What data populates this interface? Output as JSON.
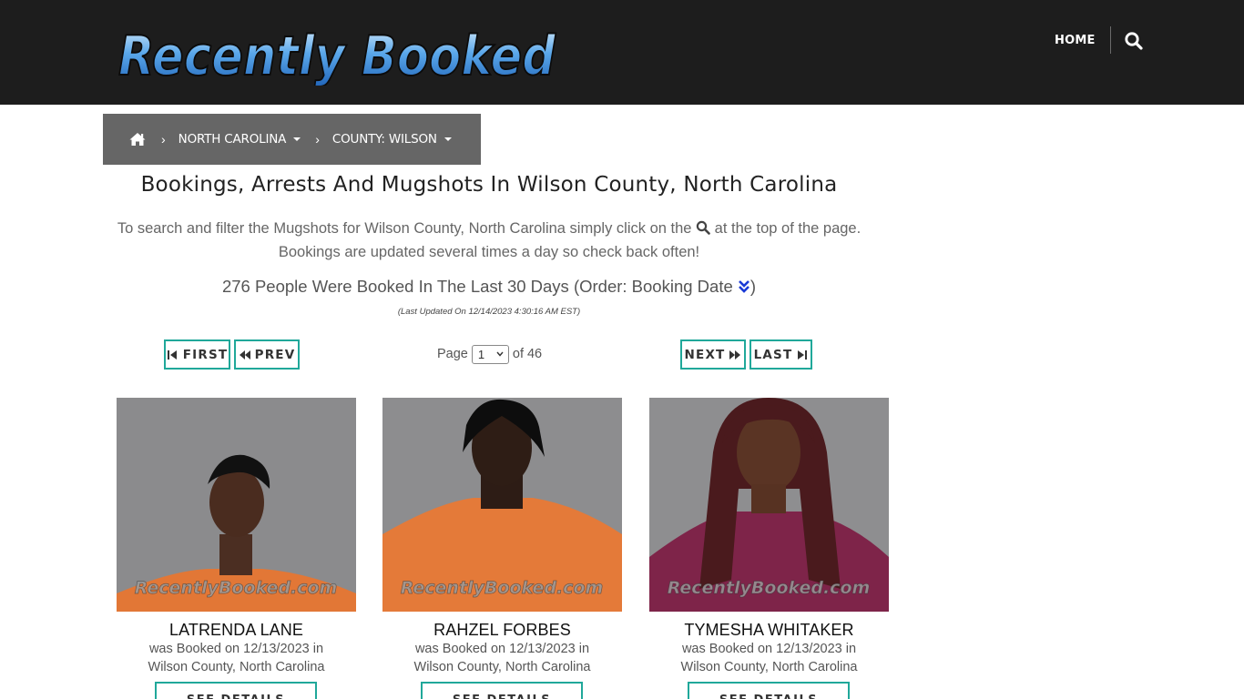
{
  "header": {
    "logo_text": "Recently Booked",
    "nav_home": "HOME",
    "search_icon": "search-icon"
  },
  "breadcrumb": {
    "home_icon": "home-icon",
    "state": "NORTH CAROLINA",
    "county": "COUNTY: WILSON"
  },
  "main": {
    "title": "Bookings, Arrests And Mugshots In Wilson County, North Carolina",
    "intro_part1": "To search and filter the Mugshots for Wilson County, North Carolina simply click on the",
    "intro_part2": "at the top of the page.",
    "intro_line2": "Bookings are updated several times a day so check back often!",
    "count_text": "276 People Were Booked In The Last 30 Days (Order: Booking Date",
    "count_close": ")",
    "last_updated": "(Last Updated On 12/14/2023 4:30:16 AM EST)"
  },
  "pager": {
    "first": "FIRST",
    "prev": "PREV",
    "next": "NEXT",
    "last": "LAST",
    "page_label": "Page",
    "page_value": "1",
    "of_label": "of 46"
  },
  "watermark": "RecentlyBooked.com",
  "people": [
    {
      "name": "LATRENDA LANE",
      "line1": "was Booked on 12/13/2023 in",
      "line2": "Wilson County, North Carolina",
      "button": "SEE DETAILS"
    },
    {
      "name": "RAHZEL FORBES",
      "line1": "was Booked on 12/13/2023 in",
      "line2": "Wilson County, North Carolina",
      "button": "SEE DETAILS"
    },
    {
      "name": "TYMESHA WHITAKER",
      "line1": "was Booked on 12/13/2023 in",
      "line2": "Wilson County, North Carolina",
      "button": "SEE DETAILS"
    }
  ],
  "colors": {
    "header_bg": "#1d1d1d",
    "breadcrumb_bg": "#666666",
    "accent_teal": "#20a89a",
    "logo_blue": "#5aa7ea"
  }
}
